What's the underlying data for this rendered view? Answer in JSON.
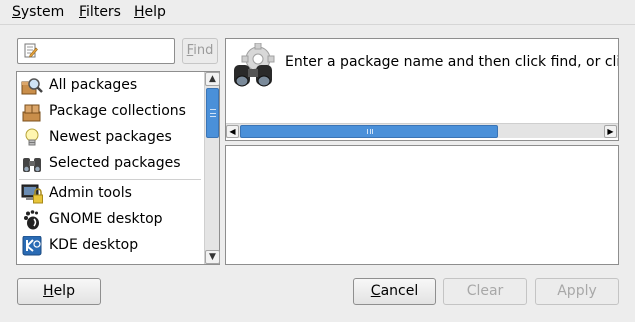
{
  "menu": {
    "system": {
      "first": "S",
      "rest": "ystem"
    },
    "filters": {
      "first": "F",
      "rest": "ilters"
    },
    "help": {
      "first": "H",
      "rest": "elp"
    }
  },
  "search": {
    "value": "",
    "placeholder": ""
  },
  "find_button": {
    "first": "F",
    "rest": "ind"
  },
  "groups": [
    {
      "label": "All packages",
      "icon": "magnifier-box-icon"
    },
    {
      "label": "Package collections",
      "icon": "box-stack-icon"
    },
    {
      "label": "Newest packages",
      "icon": "lightbulb-icon"
    },
    {
      "label": "Selected packages",
      "icon": "binoculars-icon"
    },
    {
      "label": "Admin tools",
      "icon": "admin-lock-icon"
    },
    {
      "label": "GNOME desktop",
      "icon": "gnome-foot-icon"
    },
    {
      "label": "KDE desktop",
      "icon": "kde-logo-icon"
    }
  ],
  "description": {
    "text": "Enter a package name and then click find, or click",
    "icon": "binoculars-gear-icon"
  },
  "buttons": {
    "help": {
      "first": "H",
      "rest": "elp"
    },
    "cancel": {
      "first": "C",
      "rest": "ancel"
    },
    "clear": {
      "first": "",
      "rest": "Clear"
    },
    "apply": {
      "first": "",
      "rest": "Apply"
    }
  },
  "colors": {
    "accent": "#4a90d9",
    "window_bg": "#ededed"
  }
}
